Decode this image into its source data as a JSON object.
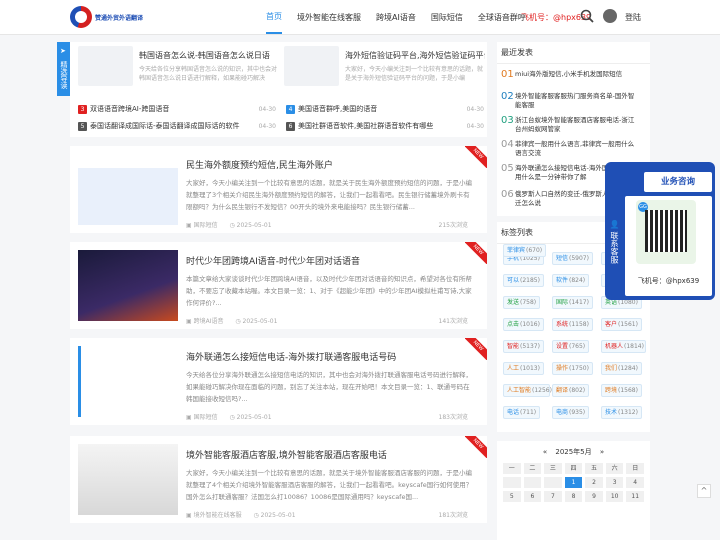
{
  "header": {
    "logo_text": "赞通外贸外语翻译",
    "nav": [
      "首页",
      "境外智能在线客服",
      "跨境AI语音",
      "国际短信",
      "全球语音群呼"
    ],
    "phone": "飞机号：@hpx639",
    "login": "登陆"
  },
  "side_tab": {
    "label": "精选导读"
  },
  "top_cards": [
    {
      "title": "韩国语音怎么说-韩国语音怎么说日语",
      "desc": "今天给各位分享韩国语音怎么说的知识，其中也会对韩国语音怎么说日语进行解释，如果能碰巧解决"
    },
    {
      "title": "海外短信验证码平台,海外短信验证码平台",
      "desc": "大家好，今天小编关注到一个比较有意思的话题，就是关于海外短信验证码平台的问题，于是小编"
    }
  ],
  "mini_list": [
    {
      "num": "3",
      "title": "双语语音跨境AI-跨国语音",
      "date": "04-30",
      "color": "#e02020"
    },
    {
      "num": "4",
      "title": "美国语音群呼,美国的语音",
      "date": "04-30",
      "color": "#2a8ee6"
    },
    {
      "num": "5",
      "title": "泰国话翻译成国际话-泰国话翻译成国际话的软件",
      "date": "04-30",
      "color": "#555555"
    },
    {
      "num": "6",
      "title": "美国社群语音软件,美国社群语音软件有哪些",
      "date": "04-30",
      "color": "#555555"
    }
  ],
  "articles": [
    {
      "title": "民生海外额度预约短信,民生海外账户",
      "desc": "大家好，今天小编关注到一个比较有意思的话题，就是关于民生海外额度预约短信的问题，于是小编就整理了3个相关介绍民生海外额度预约短信的解答，让我们一起看看吧。民生银行储蓄境外刷卡有限额吗？为什么民生银行不发短信？00开头的境外来电能接吗？民生银行储蓄...",
      "category": "国际短信",
      "date": "2025-05-01",
      "views": "215次浏览",
      "badge": "NEW"
    },
    {
      "title": "时代少年团跨境AI语音-时代少年团对话语音",
      "desc": "本篇文章给大家谈谈时代少年团跨境AI语音，以及时代少年团对话语音的知识点，希望对各位有所帮助，不要忘了收藏本站喔。本文目录一览：1、对于《超能少年团》中的少年团AI模拟杜甫写诗,大家作何评价?...",
      "category": "跨境AI语音",
      "date": "2025-05-01",
      "views": "141次浏览",
      "badge": "NEW"
    },
    {
      "title": "海外联通怎么接短信电话-海外拨打联通客服电话号码",
      "desc": "今天给各位分享海外联通怎么接短信电话的知识，其中也会对海外拨打联通客服电话号码进行解释，如果能碰巧解决你现在面临的问题，别忘了关注本站，现在开始吧！本文目录一览：1、联通号码在韩国能接收短信吗?...",
      "category": "国际短信",
      "date": "2025-05-01",
      "views": "183次浏览",
      "badge": "NEW"
    },
    {
      "title": "境外智能客服酒店客服,境外智能客服酒店客服电话",
      "desc": "大家好，今天小编关注到一个比较有意思的话题，就是关于境外智能客服酒店客服的问题，于是小编就整理了4个相关介绍境外智能客服酒店客服的解答，让我们一起看看吧。keyscafe国行如何使用？国外怎么打联通客服？法国怎么打10086？10086是国际通用吗？keyscafe国...",
      "category": "境外智能在线客服",
      "date": "2025-05-01",
      "views": "181次浏览",
      "badge": "NEW"
    }
  ],
  "recent": {
    "title": "最近发表",
    "items": [
      {
        "num": "01",
        "title": "miui海外版短信,小米手机发国际短信",
        "color": "#e07a20"
      },
      {
        "num": "02",
        "title": "境外智能客服客服热门服务商名单-国外智能客服",
        "color": "#1f7fbf"
      },
      {
        "num": "03",
        "title": "浙江台蚁境外智能客服酒店客服电话-浙江台州蚂蚁网管家",
        "color": "#1f9f7f"
      },
      {
        "num": "04",
        "title": "菲律宾一般用什么语言,菲律宾一般用什么语言交流",
        "color": "#999999"
      },
      {
        "num": "05",
        "title": "海外联通怎么接短信电话-海外国际拨打公用什么是一分钟带你了解",
        "color": "#999999"
      },
      {
        "num": "06",
        "title": "俄罗斯人口自然的变迁-俄罗斯人口自然变迁怎么说",
        "color": "#999999"
      }
    ]
  },
  "tags": {
    "title": "标签列表",
    "items": [
      {
        "label": "手机",
        "count": "(1025)",
        "color": "#2a8ee6"
      },
      {
        "label": "短信",
        "count": "(5907)",
        "color": "#2a8ee6"
      },
      {
        "label": "语音",
        "count": "(5646)",
        "color": "#2a8ee6"
      },
      {
        "label": "可以",
        "count": "(2185)",
        "color": "#2a8ee6"
      },
      {
        "label": "软件",
        "count": "(824)",
        "color": "#2a8ee6"
      },
      {
        "label": "语音",
        "count": "(5)",
        "color": "#2a8ee6"
      },
      {
        "label": "发送",
        "count": "(758)",
        "color": "#1f9f3f"
      },
      {
        "label": "国际",
        "count": "(1417)",
        "color": "#1f9f3f"
      },
      {
        "label": "英语",
        "count": "(1080)",
        "color": "#1f9f3f"
      },
      {
        "label": "点击",
        "count": "(1016)",
        "color": "#1f9f3f"
      },
      {
        "label": "系统",
        "count": "(1158)",
        "color": "#e02020"
      },
      {
        "label": "客户",
        "count": "(1561)",
        "color": "#e02020"
      },
      {
        "label": "智能",
        "count": "(5137)",
        "color": "#e02020"
      },
      {
        "label": "设置",
        "count": "(765)",
        "color": "#e02020"
      },
      {
        "label": "机器人",
        "count": "(1814)",
        "color": "#e02020"
      },
      {
        "label": "人工",
        "count": "(1013)",
        "color": "#e07a20"
      },
      {
        "label": "操作",
        "count": "(1750)",
        "color": "#e07a20"
      },
      {
        "label": "我们",
        "count": "(1284)",
        "color": "#e07a20"
      },
      {
        "label": "人工智能",
        "count": "(1256)",
        "color": "#e07a20"
      },
      {
        "label": "翻译",
        "count": "(802)",
        "color": "#e07a20"
      },
      {
        "label": "跨境",
        "count": "(1568)",
        "color": "#e07a20"
      },
      {
        "label": "电话",
        "count": "(711)",
        "color": "#2a8ee6"
      },
      {
        "label": "电商",
        "count": "(935)",
        "color": "#2a8ee6"
      },
      {
        "label": "技术",
        "count": "(1312)",
        "color": "#2a8ee6"
      },
      {
        "label": "菲律宾",
        "count": "(670)",
        "color": "#2a8ee6"
      }
    ]
  },
  "calendar": {
    "title": "2025年5月",
    "prev": "«",
    "next": "»",
    "weekdays": [
      "一",
      "二",
      "三",
      "四",
      "五",
      "六",
      "日"
    ],
    "days": [
      "",
      "",
      "",
      "1",
      "2",
      "3",
      "4",
      "5",
      "6",
      "7",
      "8",
      "9",
      "10",
      "11"
    ],
    "today": "1"
  },
  "float_panel": {
    "side_label": "联系客服",
    "head": "业务咨询",
    "qr_badge": "GG",
    "phone": "飞机号：@hpx639"
  },
  "scroll_top": "^"
}
